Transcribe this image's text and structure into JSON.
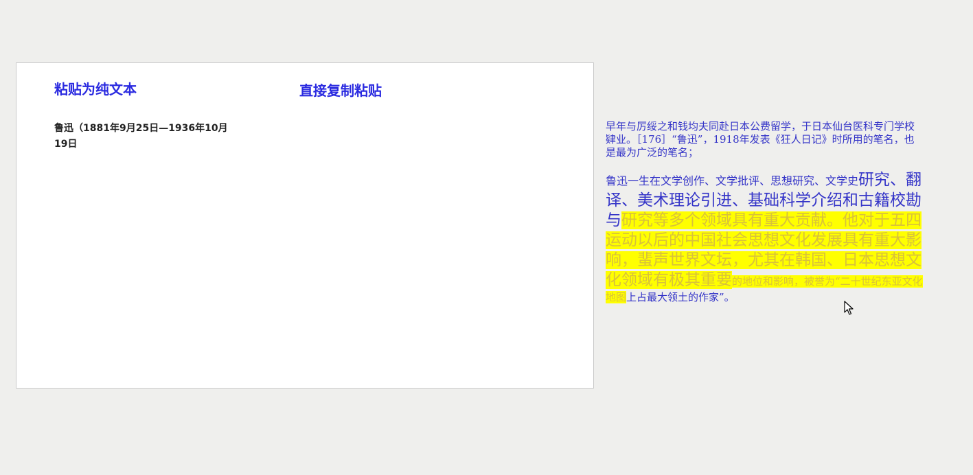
{
  "left_panel": {
    "paste_plain_title": "粘贴为纯文本",
    "direct_paste_title": "直接复制粘贴",
    "pasted_text": "鲁迅（1881年9月25日—1936年10月19日"
  },
  "source_text": {
    "para1": "早年与厉绥之和钱均夫同赴日本公费留学，于日本仙台医科专门学校肄业。［176］“鲁迅”，1918年发表《狂人日记》时所用的笔名，也是最为广泛的笔名；",
    "para2_small": "鲁迅一生在文学创作、文学批评、思想研究、文学史",
    "para2_large": "研究、翻译、美术理论引进、基础科学介绍和古籍校勘与",
    "para2_highlight_large": "研究等多个领域具有重大贡献。他对于五四运动以后的中国社会思想文化发展具有重大影响，蜚声世界文坛，尤其在韩国、日本思想文化领域有极其重要",
    "para2_highlight_small": "的地位和影响，被誉为“二十世纪东亚文化地图",
    "para2_tail": "上占最大领土的作家”。"
  },
  "colors": {
    "title": "#2a2ae0",
    "source_text": "#3434c8",
    "highlight_bg": "#ffff00",
    "highlight_text": "#d9c23a"
  },
  "icons": {
    "cursor": "mouse-pointer-icon"
  }
}
